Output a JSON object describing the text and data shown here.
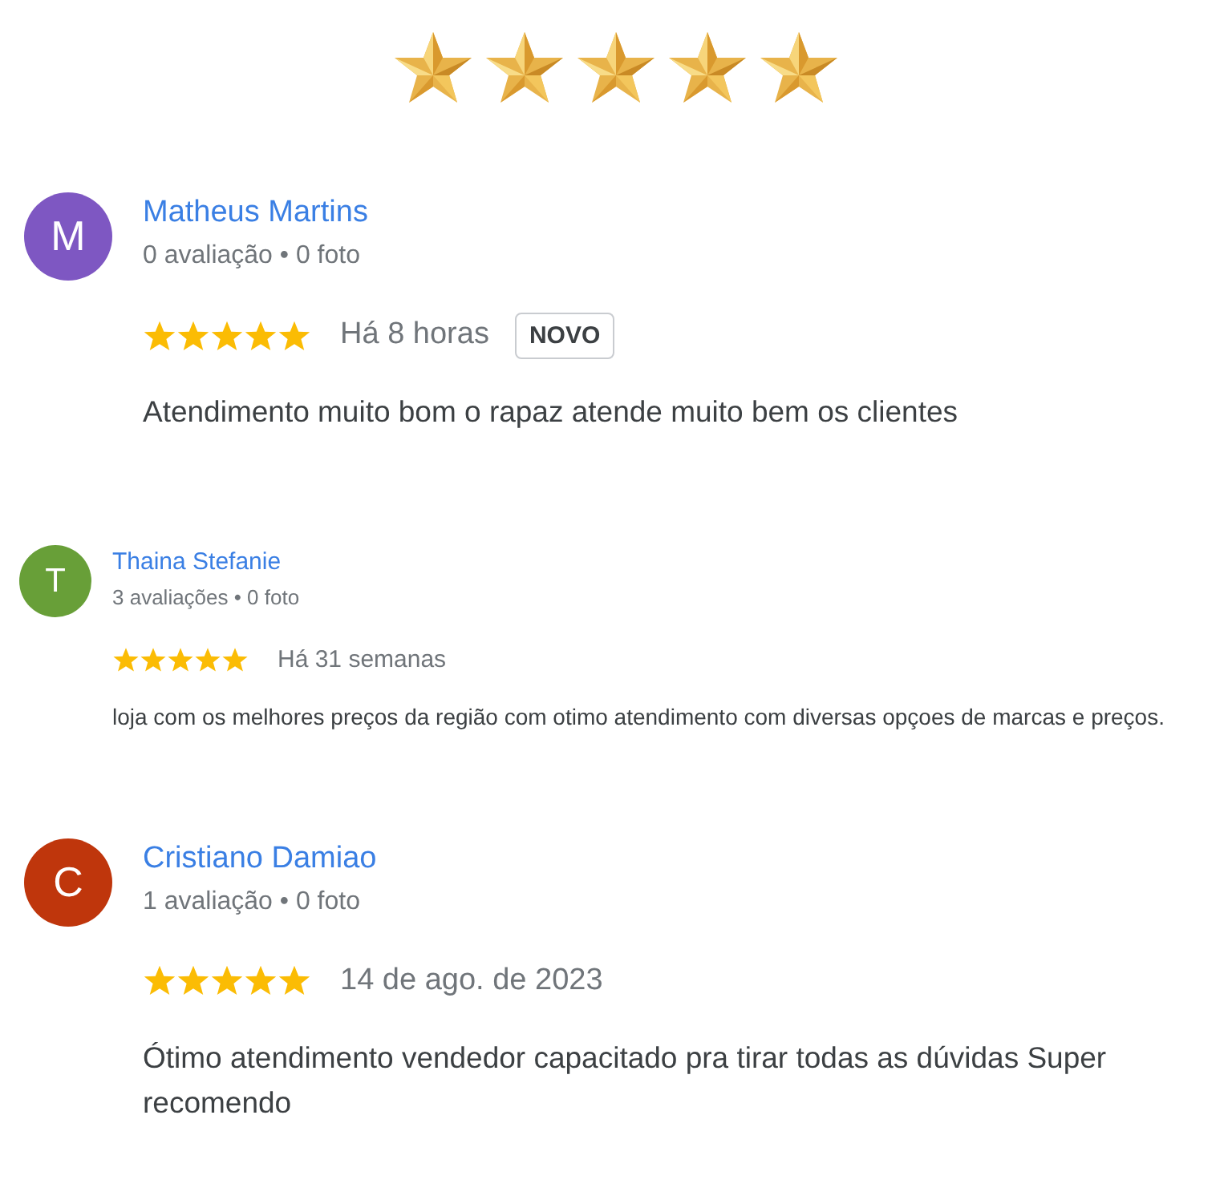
{
  "header": {
    "stars": 5
  },
  "reviews": [
    {
      "kind": "large",
      "initial": "M",
      "color": "#7e57c2",
      "name": "Matheus Martins",
      "meta": "0 avaliação • 0 foto",
      "stars": 5,
      "time": "Há 8 horas",
      "badge": "NOVO",
      "text": "Atendimento muito bom o rapaz atende muito bem os clientes"
    },
    {
      "kind": "compact",
      "initial": "T",
      "color": "#689f38",
      "name": "Thaina Stefanie",
      "meta": "3 avaliações • 0 foto",
      "stars": 5,
      "time": "Há 31 semanas",
      "text": "loja com os melhores preços da região com otimo atendimento com diversas opçoes de marcas e preços."
    },
    {
      "kind": "large",
      "initial": "C",
      "color": "#bf360c",
      "name": "Cristiano Damiao",
      "meta": "1 avaliação • 0 foto",
      "stars": 5,
      "time": "14 de ago. de 2023",
      "text": "Ótimo atendimento vendedor capacitado pra tirar todas as dúvidas Super recomendo"
    }
  ]
}
